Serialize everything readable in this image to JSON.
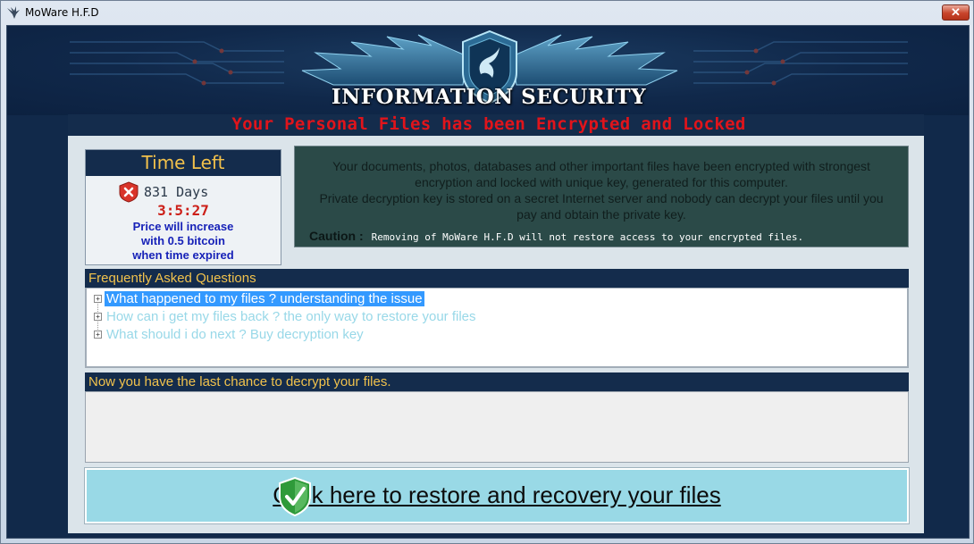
{
  "window": {
    "title": "MoWare H.F.D",
    "close_label": "✕"
  },
  "banner": {
    "title": "INFORMATION SECURITY",
    "headline": "Your Personal Files has been Encrypted and Locked"
  },
  "timer": {
    "heading": "Time Left",
    "days": "831 Days",
    "clock": "3:5:27",
    "price_line1": "Price will increase",
    "price_line2": "with 0.5 bitcoin",
    "price_line3": "when time expired"
  },
  "message": {
    "line1": "Your documents, photos, databases and other important files have been encrypted with strongest",
    "line2": "encryption and locked with unique key, generated for this computer.",
    "line3": "Private decryption key is stored on a secret Internet server and nobody can decrypt your files until you",
    "line4": "pay and obtain the private key.",
    "caution_label": "Caution :",
    "caution_text": "Removing of MoWare H.F.D will not restore access to your encrypted files."
  },
  "faq": {
    "heading": "Frequently Asked Questions",
    "items": [
      {
        "label": "What happened to my files ? understanding  the issue",
        "selected": true
      },
      {
        "label": "How can i get my files back ? the only way to restore your files",
        "selected": false
      },
      {
        "label": "What should i do next ? Buy decryption key",
        "selected": false
      }
    ]
  },
  "chance": {
    "heading": "Now you have the last chance to decrypt your files."
  },
  "restore_button": {
    "label": "Click here to restore and recovery your files"
  },
  "colors": {
    "background": "#11294a",
    "accent_gold": "#f1c24c",
    "headline_red": "#e0141b",
    "button_cyan": "#99d9e6",
    "selection_blue": "#3399ff"
  },
  "icons": [
    "eagle-icon",
    "close-icon",
    "emblem-shield-icon",
    "error-x-icon",
    "expander-plus-icon",
    "check-shield-icon"
  ]
}
